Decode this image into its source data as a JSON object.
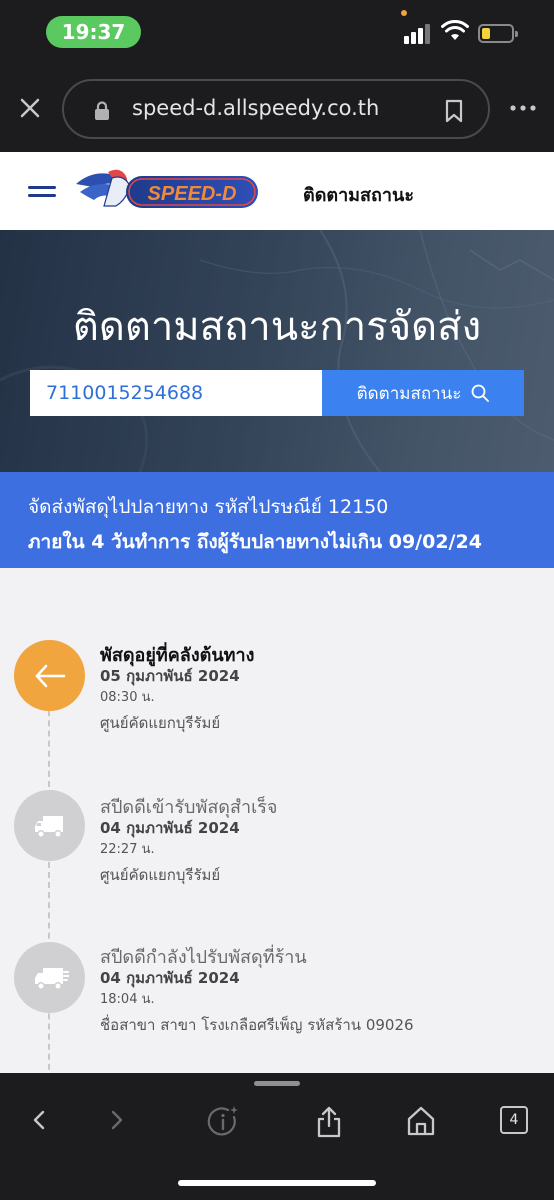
{
  "status_bar": {
    "time": "19:37"
  },
  "browser": {
    "url": "speed-d.allspeedy.co.th",
    "tab_count": "4"
  },
  "site": {
    "logo_text": "SPEED-D",
    "nav_link": "ติดตามสถานะ",
    "hero_title": "ติดตามสถานะการจัดส่ง",
    "tracking_number": "7110015254688",
    "track_button": "ติดตามสถานะ"
  },
  "info": {
    "line1": "จัดส่งพัสดุไปปลายทาง รหัสไปรษณีย์ 12150",
    "line2": "ภายใน 4 วันทำการ ถึงผู้รับปลายทางไม่เกิน 09/02/24"
  },
  "timeline": [
    {
      "title": "พัสดุอยู่ที่คลังต้นทาง",
      "date": "05 กุมภาพันธ์ 2024",
      "time": "08:30 น.",
      "place": "ศูนย์คัดแยกบุรีรัมย์",
      "icon": "arrow-left-icon",
      "active": true
    },
    {
      "title": "สปีดดีเข้ารับพัสดุสำเร็จ",
      "date": "04 กุมภาพันธ์ 2024",
      "time": "22:27 น.",
      "place": "ศูนย์คัดแยกบุรีรัมย์",
      "icon": "truck-icon",
      "active": false
    },
    {
      "title": "สปีดดีกำลังไปรับพัสดุที่ร้าน",
      "date": "04 กุมภาพันธ์ 2024",
      "time": "18:04 น.",
      "place": "ชื่อสาขา สาขา โรงเกลือศรีเพ็ญ รหัสร้าน 09026",
      "icon": "fast-truck-icon",
      "active": false
    }
  ],
  "colors": {
    "brand_blue": "#3d6fe0",
    "button_blue": "#3b82f0",
    "active_orange": "#f0a53e",
    "status_green": "#5ac95f"
  }
}
